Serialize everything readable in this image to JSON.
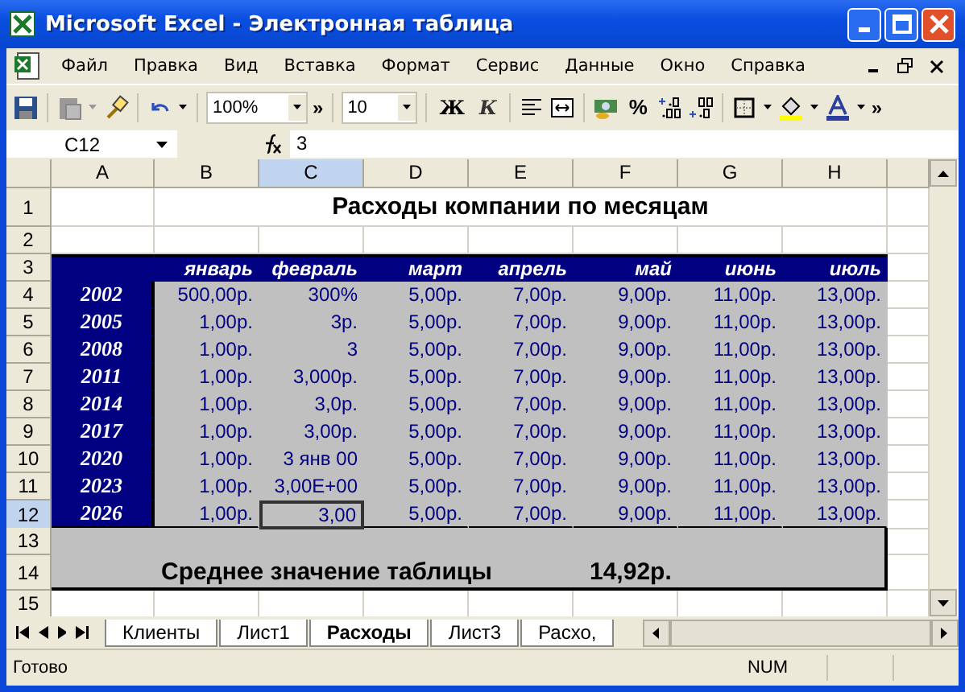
{
  "window": {
    "title": "Microsoft Excel - Электронная таблица"
  },
  "menu": [
    "Файл",
    "Правка",
    "Вид",
    "Вставка",
    "Формат",
    "Сервис",
    "Данные",
    "Окно",
    "Справка"
  ],
  "toolbar": {
    "zoom": "100%",
    "font_size": "10",
    "bold": "Ж",
    "italic": "К",
    "percent": "%",
    "more": "»"
  },
  "formula_bar": {
    "name_box": "C12",
    "value": "3"
  },
  "columns": [
    {
      "label": "A",
      "selected": false
    },
    {
      "label": "B",
      "selected": false
    },
    {
      "label": "C",
      "selected": true
    },
    {
      "label": "D",
      "selected": false
    },
    {
      "label": "E",
      "selected": false
    },
    {
      "label": "F",
      "selected": false
    },
    {
      "label": "G",
      "selected": false
    },
    {
      "label": "H",
      "selected": false
    }
  ],
  "rows": [
    {
      "number": "1",
      "selected": false,
      "kind": "title",
      "text": "Расходы компании по месяцам"
    },
    {
      "number": "2",
      "selected": false,
      "kind": "blank"
    },
    {
      "number": "3",
      "selected": false,
      "kind": "header",
      "cells": [
        "январь",
        "февраль",
        "март",
        "апрель",
        "май",
        "июнь",
        "июль"
      ]
    },
    {
      "number": "4",
      "selected": false,
      "kind": "data",
      "year": "2002",
      "cells": [
        {
          "text": "500,00р.",
          "selected": false
        },
        {
          "text": "300%",
          "selected": false
        },
        {
          "text": "5,00р.",
          "selected": false
        },
        {
          "text": "7,00р.",
          "selected": false
        },
        {
          "text": "9,00р.",
          "selected": false
        },
        {
          "text": "11,00р.",
          "selected": false
        },
        {
          "text": "13,00р.",
          "selected": false
        }
      ]
    },
    {
      "number": "5",
      "selected": false,
      "kind": "data",
      "year": "2005",
      "cells": [
        {
          "text": "1,00р.",
          "selected": false
        },
        {
          "text": "3р.",
          "selected": false
        },
        {
          "text": "5,00р.",
          "selected": false
        },
        {
          "text": "7,00р.",
          "selected": false
        },
        {
          "text": "9,00р.",
          "selected": false
        },
        {
          "text": "11,00р.",
          "selected": false
        },
        {
          "text": "13,00р.",
          "selected": false
        }
      ]
    },
    {
      "number": "6",
      "selected": false,
      "kind": "data",
      "year": "2008",
      "cells": [
        {
          "text": "1,00р.",
          "selected": false
        },
        {
          "text": "3",
          "selected": false
        },
        {
          "text": "5,00р.",
          "selected": false
        },
        {
          "text": "7,00р.",
          "selected": false
        },
        {
          "text": "9,00р.",
          "selected": false
        },
        {
          "text": "11,00р.",
          "selected": false
        },
        {
          "text": "13,00р.",
          "selected": false
        }
      ]
    },
    {
      "number": "7",
      "selected": false,
      "kind": "data",
      "year": "2011",
      "cells": [
        {
          "text": "1,00р.",
          "selected": false
        },
        {
          "text": "3,000р.",
          "selected": false
        },
        {
          "text": "5,00р.",
          "selected": false
        },
        {
          "text": "7,00р.",
          "selected": false
        },
        {
          "text": "9,00р.",
          "selected": false
        },
        {
          "text": "11,00р.",
          "selected": false
        },
        {
          "text": "13,00р.",
          "selected": false
        }
      ]
    },
    {
      "number": "8",
      "selected": false,
      "kind": "data",
      "year": "2014",
      "cells": [
        {
          "text": "1,00р.",
          "selected": false
        },
        {
          "text": "3,0р.",
          "selected": false
        },
        {
          "text": "5,00р.",
          "selected": false
        },
        {
          "text": "7,00р.",
          "selected": false
        },
        {
          "text": "9,00р.",
          "selected": false
        },
        {
          "text": "11,00р.",
          "selected": false
        },
        {
          "text": "13,00р.",
          "selected": false
        }
      ]
    },
    {
      "number": "9",
      "selected": false,
      "kind": "data",
      "year": "2017",
      "cells": [
        {
          "text": "1,00р.",
          "selected": false
        },
        {
          "text": "3,00р.",
          "selected": false
        },
        {
          "text": "5,00р.",
          "selected": false
        },
        {
          "text": "7,00р.",
          "selected": false
        },
        {
          "text": "9,00р.",
          "selected": false
        },
        {
          "text": "11,00р.",
          "selected": false
        },
        {
          "text": "13,00р.",
          "selected": false
        }
      ]
    },
    {
      "number": "10",
      "selected": false,
      "kind": "data",
      "year": "2020",
      "cells": [
        {
          "text": "1,00р.",
          "selected": false
        },
        {
          "text": "3 янв 00",
          "selected": false
        },
        {
          "text": "5,00р.",
          "selected": false
        },
        {
          "text": "7,00р.",
          "selected": false
        },
        {
          "text": "9,00р.",
          "selected": false
        },
        {
          "text": "11,00р.",
          "selected": false
        },
        {
          "text": "13,00р.",
          "selected": false
        }
      ]
    },
    {
      "number": "11",
      "selected": false,
      "kind": "data",
      "year": "2023",
      "cells": [
        {
          "text": "1,00р.",
          "selected": false
        },
        {
          "text": "3,00E+00",
          "selected": false
        },
        {
          "text": "5,00р.",
          "selected": false
        },
        {
          "text": "7,00р.",
          "selected": false
        },
        {
          "text": "9,00р.",
          "selected": false
        },
        {
          "text": "11,00р.",
          "selected": false
        },
        {
          "text": "13,00р.",
          "selected": false
        }
      ]
    },
    {
      "number": "12",
      "selected": true,
      "kind": "data",
      "year": "2026",
      "cells": [
        {
          "text": "1,00р.",
          "selected": false
        },
        {
          "text": "3,00",
          "selected": true
        },
        {
          "text": "5,00р.",
          "selected": false
        },
        {
          "text": "7,00р.",
          "selected": false
        },
        {
          "text": "9,00р.",
          "selected": false
        },
        {
          "text": "11,00р.",
          "selected": false
        },
        {
          "text": "13,00р.",
          "selected": false
        }
      ]
    },
    {
      "number": "13",
      "selected": false,
      "kind": "summary_blank"
    },
    {
      "number": "14",
      "selected": false,
      "kind": "summary",
      "label": "Среднее значение таблицы",
      "value": "14,92р."
    },
    {
      "number": "15",
      "selected": false,
      "kind": "blank"
    }
  ],
  "sheet_tabs": [
    {
      "label": "Клиенты",
      "selected": false
    },
    {
      "label": "Лист1",
      "selected": false
    },
    {
      "label": "Расходы",
      "selected": true
    },
    {
      "label": "Лист3",
      "selected": false
    },
    {
      "label": "Расхо,",
      "selected": false
    }
  ],
  "status_bar": {
    "text": "Готово",
    "num": "NUM"
  }
}
